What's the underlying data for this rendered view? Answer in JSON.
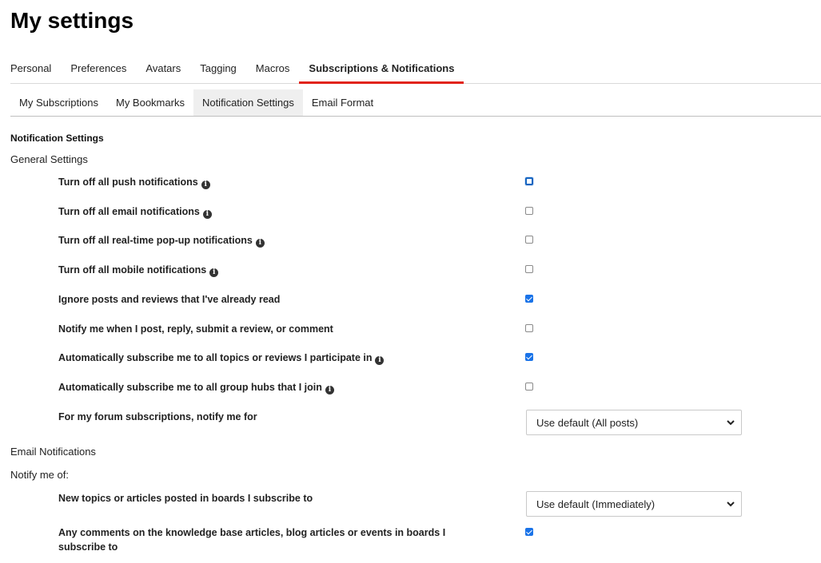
{
  "page": {
    "title": "My settings"
  },
  "main_tabs": [
    {
      "label": "Personal"
    },
    {
      "label": "Preferences"
    },
    {
      "label": "Avatars"
    },
    {
      "label": "Tagging"
    },
    {
      "label": "Macros"
    },
    {
      "label": "Subscriptions & Notifications",
      "active": true
    }
  ],
  "sub_tabs": [
    {
      "label": "My Subscriptions"
    },
    {
      "label": "My Bookmarks"
    },
    {
      "label": "Notification Settings",
      "active": true
    },
    {
      "label": "Email Format"
    }
  ],
  "notification": {
    "section_title": "Notification Settings",
    "general_label": "General Settings",
    "settings": [
      {
        "label": "Turn off all push notifications",
        "info": true,
        "checked": false
      },
      {
        "label": "Turn off all email notifications",
        "info": true,
        "checked": false
      },
      {
        "label": "Turn off all real-time pop-up notifications",
        "info": true,
        "checked": false
      },
      {
        "label": "Turn off all mobile notifications",
        "info": true,
        "checked": false
      },
      {
        "label": "Ignore posts and reviews that I've already read",
        "info": false,
        "checked": true
      },
      {
        "label": "Notify me when I post, reply, submit a review, or comment",
        "info": false,
        "checked": false
      },
      {
        "label": "Automatically subscribe me to all topics or reviews I participate in",
        "info": true,
        "checked": true
      },
      {
        "label": "Automatically subscribe me to all group hubs that I join",
        "info": true,
        "checked": false
      }
    ],
    "forum_label": "For my forum subscriptions, notify me for",
    "forum_select": "Use default (All posts)",
    "email_label": "Email Notifications",
    "notify_of_label": "Notify me of:",
    "new_topics_label": "New topics or articles posted in boards I subscribe to",
    "new_topics_select": "Use default (Immediately)",
    "comments_label": "Any comments on the knowledge base articles, blog articles or events in boards I subscribe to",
    "comments_checked": true
  },
  "icons": {
    "info": "info-circle-icon",
    "chevron": "chevron-down-icon"
  },
  "colors": {
    "active_tab_underline": "#e1231a",
    "checkbox_checked": "#1a73e8",
    "focus_ring": "#1565c0"
  }
}
